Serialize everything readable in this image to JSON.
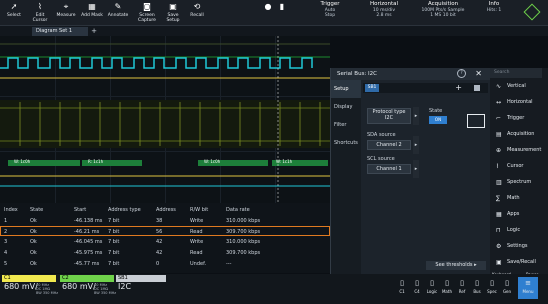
{
  "toolbar": {
    "buttons": [
      {
        "label": "Select",
        "icon": "pointer-icon"
      },
      {
        "label": "Edit Cursor",
        "icon": "cursor-icon"
      },
      {
        "label": "Measure",
        "icon": "measure-icon"
      },
      {
        "label": "Add Mask",
        "icon": "mask-icon"
      },
      {
        "label": "Annotate",
        "icon": "pen-icon"
      },
      {
        "label": "Screen Capture",
        "icon": "camera-icon"
      },
      {
        "label": "Save Setup",
        "icon": "save-icon"
      },
      {
        "label": "Recall",
        "icon": "recall-icon"
      }
    ],
    "trigger": {
      "header": "Trigger",
      "mode": "Auto",
      "state": "Stop"
    },
    "horizontal": {
      "header": "Horizontal",
      "timebase": "10 ms/div",
      "rate": "2.8 ms"
    },
    "acquisition": {
      "header": "Acquisition",
      "samples": "100M Pts/s",
      "record": "1 MS",
      "samples2": "Sample",
      "bits": "10 bit"
    },
    "info": {
      "header": "Info",
      "value": "Hits: 1"
    }
  },
  "diagram_tab": {
    "label": "Diagram Set 1",
    "plus": "+"
  },
  "bus_labels": {
    "left": "W: 1c0h",
    "mid": "R: 1c1h",
    "right": "W: 1c0h",
    "far": "W: 1c1h"
  },
  "dialog": {
    "title": "Serial Bus: I2C",
    "tabs": [
      "Setup",
      "Display",
      "Filter",
      "Shortcuts"
    ],
    "bus_chip": "SB1",
    "protocol_label": "Protocol type",
    "protocol_value": "I2C",
    "state_label": "State",
    "state_value": "ON",
    "sda_label": "SDA source",
    "sda_value": "Channel 2",
    "scl_label": "SCL source",
    "scl_value": "Channel 1",
    "thresholds_button": "See thresholds ▸"
  },
  "sidebar": {
    "search_placeholder": "Search",
    "items": [
      {
        "label": "Vertical",
        "icon": "vertical-icon"
      },
      {
        "label": "Horizontal",
        "icon": "horizontal-icon"
      },
      {
        "label": "Trigger",
        "icon": "trigger-icon"
      },
      {
        "label": "Acquisition",
        "icon": "acquisition-icon"
      },
      {
        "label": "Measurement",
        "icon": "measurement-icon"
      },
      {
        "label": "Cursor",
        "icon": "cursor-icon"
      },
      {
        "label": "Spectrum",
        "icon": "spectrum-icon"
      },
      {
        "label": "Math",
        "icon": "math-icon"
      },
      {
        "label": "Apps",
        "icon": "apps-icon"
      },
      {
        "label": "Logic",
        "icon": "logic-icon"
      },
      {
        "label": "Settings",
        "icon": "settings-icon"
      },
      {
        "label": "Save/Recall",
        "icon": "save-icon"
      }
    ],
    "keyboard": "Keyboard",
    "power": "Power"
  },
  "table": {
    "headers": [
      "Index",
      "State",
      "Start",
      "Address type",
      "Address",
      "R/W bit",
      "Data rate"
    ],
    "rows": [
      [
        "1",
        "Ok",
        "-46.138 ms",
        "7 bit",
        "38",
        "Write",
        "310.000 kbps"
      ],
      [
        "2",
        "Ok",
        "-46.21 ms",
        "7 bit",
        "56",
        "Read",
        "309.700 kbps"
      ],
      [
        "3",
        "Ok",
        "-46.045 ms",
        "7 bit",
        "42",
        "Write",
        "310.000 kbps"
      ],
      [
        "4",
        "Ok",
        "-45.975 ms",
        "7 bit",
        "42",
        "Read",
        "309.700 kbps"
      ],
      [
        "5",
        "Ok",
        "-45.77 ms",
        "7 bit",
        "0",
        "Undef.",
        "---"
      ]
    ]
  },
  "bottom": {
    "c1": {
      "label": "C1",
      "value": "680 mV/",
      "sub1": "10 MHz",
      "sub2": "DC 1MΩ",
      "sub3": "BW 350 MHz",
      "color": "#f1e94f"
    },
    "c2": {
      "label": "C2",
      "value": "680 mV/",
      "sub1": "10 MHz",
      "sub2": "DC 1MΩ",
      "sub3": "BW 350 MHz",
      "color": "#6fd24a"
    },
    "sb1": {
      "label": "SB1",
      "value": "I2C",
      "color": "#c9ced4"
    },
    "buttons": [
      "C1",
      "C4",
      "Logic",
      "Math",
      "Ref",
      "Bus",
      "Spec",
      "Gen",
      "Menu"
    ]
  }
}
